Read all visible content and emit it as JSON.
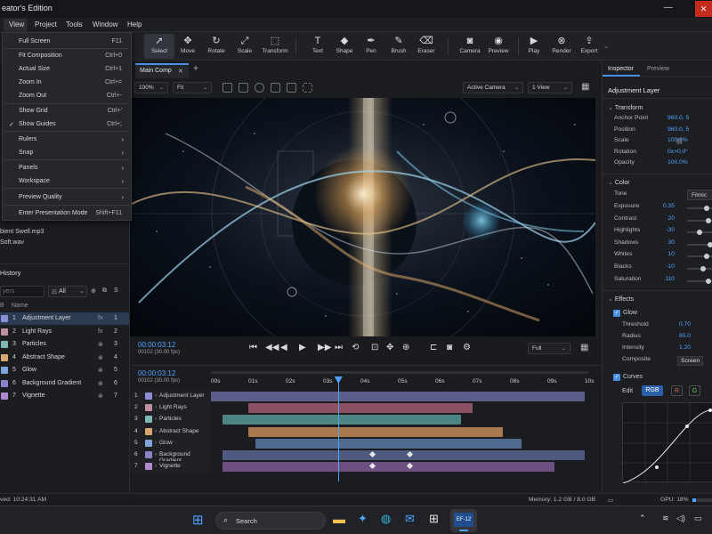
{
  "app": {
    "title": "eator's Edition"
  },
  "menu": [
    "View",
    "Project",
    "Tools",
    "Window",
    "Help"
  ],
  "tools": [
    {
      "label": "Select",
      "icon": "select-arrow-icon"
    },
    {
      "label": "Move",
      "icon": "move-icon"
    },
    {
      "label": "Rotate",
      "icon": "rotate-icon"
    },
    {
      "label": "Scale",
      "icon": "scale-icon"
    },
    {
      "label": "Transform",
      "icon": "transform-icon"
    },
    {
      "label": "Text",
      "icon": "text-icon"
    },
    {
      "label": "Shape",
      "icon": "shape-icon"
    },
    {
      "label": "Pen",
      "icon": "pen-icon"
    },
    {
      "label": "Brush",
      "icon": "brush-icon"
    },
    {
      "label": "Eraser",
      "icon": "eraser-icon"
    },
    {
      "label": "Camera",
      "icon": "camera-icon"
    },
    {
      "label": "Preview",
      "icon": "eye-icon"
    },
    {
      "label": "Play",
      "icon": "play-icon"
    },
    {
      "label": "Render",
      "icon": "render-icon"
    },
    {
      "label": "Export",
      "icon": "export-icon"
    }
  ],
  "view_menu": [
    {
      "label": "Full Screen",
      "shortcut": "F11"
    },
    {
      "label": "Fit Composition",
      "shortcut": "Ctrl+0"
    },
    {
      "label": "Actual Size",
      "shortcut": "Ctrl+1"
    },
    {
      "label": "Zoom In",
      "shortcut": "Ctrl+="
    },
    {
      "label": "Zoom Out",
      "shortcut": "Ctrl+-"
    },
    {
      "label": "Show Grid",
      "shortcut": "Ctrl+'"
    },
    {
      "label": "Show Guides",
      "shortcut": "Ctrl+;"
    },
    {
      "label": "Rulers",
      "shortcut": "›"
    },
    {
      "label": "Snap",
      "shortcut": "›"
    },
    {
      "label": "Panels",
      "shortcut": "›"
    },
    {
      "label": "Workspace",
      "shortcut": "›"
    },
    {
      "label": "Preview Quality",
      "shortcut": "›"
    },
    {
      "label": "Enter Presentation Mode",
      "shortcut": "Shift+F11"
    }
  ],
  "assets": [
    "bient Swell.mp3",
    "Soft.wav"
  ],
  "history_label": "History",
  "layers_search_placeholder": "yers",
  "layers_filter": "All",
  "layers_header": {
    "col1": "B",
    "col2": "Name"
  },
  "layers": [
    {
      "num": "1",
      "name": "Adjustment Layer",
      "color": "#8a8fd8",
      "flag": "fx",
      "idx": "1"
    },
    {
      "num": "2",
      "name": "Light Rays",
      "color": "#c08fa0",
      "flag": "fx",
      "idx": "2"
    },
    {
      "num": "3",
      "name": "Particles",
      "color": "#7fb8b5",
      "flag": "⊗",
      "idx": "3"
    },
    {
      "num": "4",
      "name": "Abstract Shape",
      "color": "#d8a670",
      "flag": "⊗",
      "idx": "4"
    },
    {
      "num": "5",
      "name": "Glow",
      "color": "#7fa6d8",
      "flag": "⊗",
      "idx": "5"
    },
    {
      "num": "6",
      "name": "Background Gradient",
      "color": "#8a82c8",
      "flag": "⊗",
      "idx": "6"
    },
    {
      "num": "7",
      "name": "Vignette",
      "color": "#b08ad0",
      "flag": "⊗",
      "idx": "7"
    }
  ],
  "comp_tab": "Main Comp",
  "zoom": "100%",
  "fit": "Fit",
  "camera": "Active Camera",
  "views": "1 View",
  "timecode": "00:00:03:12",
  "frames": "00102 (30.00 fps)",
  "quality": "Full",
  "ruler": [
    "00s",
    "01s",
    "02s",
    "03s",
    "04s",
    "05s",
    "06s",
    "07s",
    "08s",
    "09s",
    "10s"
  ],
  "tracks": [
    {
      "num": "1",
      "name": "Adjustment Layer",
      "color": "#8a8fd8",
      "bar": "#5c5f8a",
      "start": 0,
      "end": 10,
      "keys": []
    },
    {
      "num": "2",
      "name": "Light Rays",
      "color": "#c08fa0",
      "bar": "#8a5262",
      "start": 1,
      "end": 7,
      "keys": []
    },
    {
      "num": "3",
      "name": "Particles",
      "color": "#7fb8b5",
      "bar": "#4d8584",
      "start": 0.3,
      "end": 6.7,
      "keys": []
    },
    {
      "num": "4",
      "name": "Abstract Shape",
      "color": "#d8a670",
      "bar": "#a87a4e",
      "start": 1,
      "end": 7.8,
      "keys": []
    },
    {
      "num": "5",
      "name": "Glow",
      "color": "#7fa6d8",
      "bar": "#4f6a8e",
      "start": 1.2,
      "end": 8.3,
      "keys": []
    },
    {
      "num": "6",
      "name": "Background Gradient",
      "color": "#8a82c8",
      "bar": "#4f5a80",
      "start": 0.3,
      "end": 10,
      "keys": [
        4.3,
        5.3
      ]
    },
    {
      "num": "7",
      "name": "Vignette",
      "color": "#b08ad0",
      "bar": "#6e4f82",
      "start": 0.3,
      "end": 9.2,
      "keys": [
        4.3,
        5.3
      ]
    }
  ],
  "playhead_sec": 3.4,
  "inspector": {
    "tab1": "Inspector",
    "tab2": "Preview",
    "layer": "Adjustment Layer",
    "transform_title": "Transform",
    "transform": [
      {
        "k": "Anchor Point",
        "v": "960.0, 5"
      },
      {
        "k": "Position",
        "v": "960.0, 5"
      },
      {
        "k": "Scale",
        "v": "100.0%"
      },
      {
        "k": "Rotation",
        "v": "0x+0.0°"
      },
      {
        "k": "Opacity",
        "v": "100.0%"
      }
    ],
    "color_title": "Color",
    "tone_label": "Tone",
    "tone_value": "Filmic",
    "color": [
      {
        "k": "Exposure",
        "v": "0.35",
        "level": 0.55
      },
      {
        "k": "Contrast",
        "v": "20",
        "level": 0.6
      },
      {
        "k": "Highlights",
        "v": "-30",
        "level": 0.35
      },
      {
        "k": "Shadows",
        "v": "30",
        "level": 0.65
      },
      {
        "k": "Whites",
        "v": "10",
        "level": 0.55
      },
      {
        "k": "Blacks",
        "v": "-10",
        "level": 0.45
      },
      {
        "k": "Saturation",
        "v": "110",
        "level": 0.6
      }
    ],
    "effects_title": "Effects",
    "glow_label": "Glow",
    "glow": [
      {
        "k": "Threshold",
        "v": "0.70"
      },
      {
        "k": "Radius",
        "v": "85.0"
      },
      {
        "k": "Intensity",
        "v": "1.20"
      },
      {
        "k": "Composite",
        "v": "Screen"
      }
    ],
    "curves_label": "Curves",
    "edit_label": "Edit",
    "channels": [
      "RGB",
      "R",
      "G"
    ]
  },
  "status": {
    "saved": "ved: 10:24:31 AM",
    "memory": "Memory: 1.2 GB / 8.0 GB",
    "gpu": "GPU: 18%"
  },
  "taskbar": {
    "search": "Search",
    "app_badge": "EF-12"
  }
}
